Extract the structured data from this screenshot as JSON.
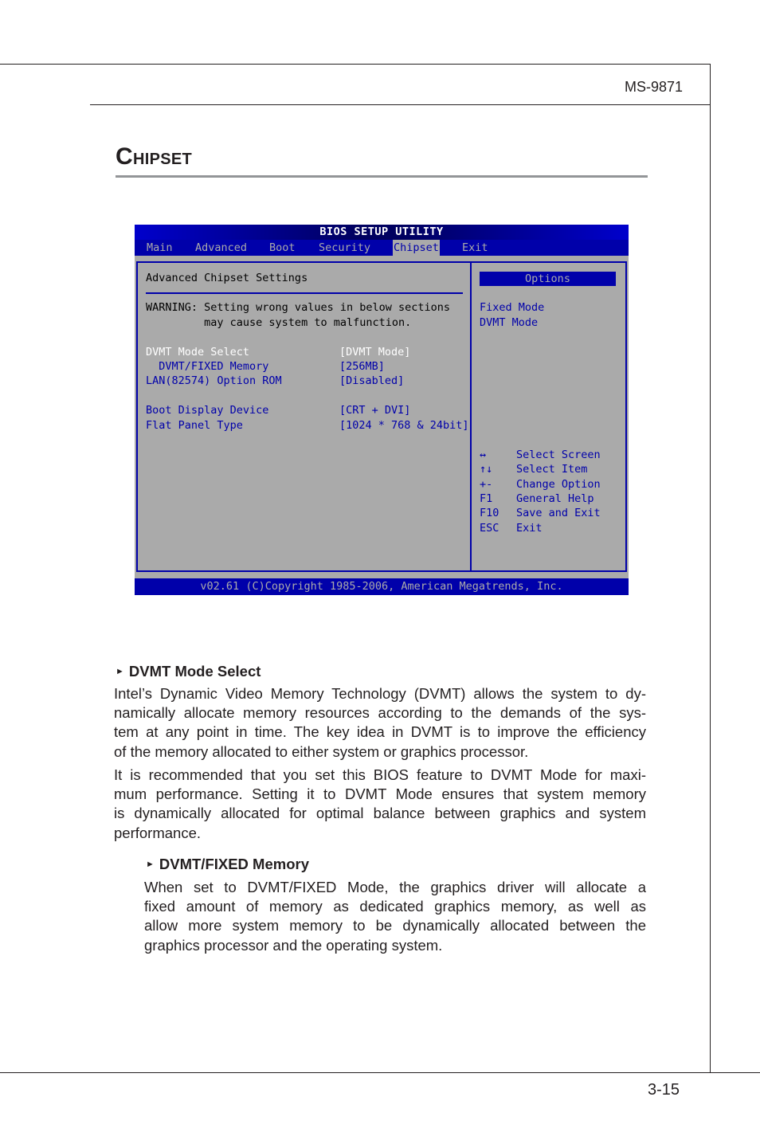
{
  "header": {
    "model": "MS-9871"
  },
  "section": {
    "title_cap": "C",
    "title_rest": "HIPSET"
  },
  "bios": {
    "title": "BIOS SETUP UTILITY",
    "tabs": [
      {
        "label": "Main",
        "active": false
      },
      {
        "label": "Advanced",
        "active": false
      },
      {
        "label": "Boot",
        "active": false
      },
      {
        "label": "Security",
        "active": false
      },
      {
        "label": "Chipset",
        "active": true
      },
      {
        "label": "Exit",
        "active": false
      }
    ],
    "panel_title": "Advanced Chipset Settings",
    "warning_line1": "WARNING: Setting wrong values in below sections",
    "warning_line2": "         may cause system to malfunction.",
    "settings": [
      {
        "label": "DVMT Mode Select",
        "value": "[DVMT Mode]",
        "selected": true
      },
      {
        "label": "  DVMT/FIXED Memory",
        "value": "[256MB]",
        "selected": false
      },
      {
        "label": "LAN(82574) Option ROM",
        "value": "[Disabled]",
        "selected": false
      },
      {
        "label": "Boot Display Device",
        "value": "[CRT + DVI]",
        "selected": false
      },
      {
        "label": "Flat Panel Type",
        "value": "[1024 * 768 & 24bit]",
        "selected": false
      }
    ],
    "options_header": "Options",
    "options": [
      "Fixed Mode",
      "DVMT Mode"
    ],
    "help": [
      {
        "key": "↔",
        "action": "Select Screen"
      },
      {
        "key": "↑↓",
        "action": "Select Item"
      },
      {
        "key": "+-",
        "action": "Change Option"
      },
      {
        "key": "F1",
        "action": "General Help"
      },
      {
        "key": "F10",
        "action": "Save and Exit"
      },
      {
        "key": "ESC",
        "action": "Exit"
      }
    ],
    "footer": "v02.61 (C)Copyright 1985-2006, American Megatrends, Inc."
  },
  "content": {
    "sub1": {
      "heading": "DVMT Mode Select",
      "para1": [
        "Intel’s Dynamic Video Memory Technology (DVMT) allows the system to dy-",
        "namically allocate memory resources according to the demands of the sys-",
        "tem at any point in time. The key idea in DVMT is to improve the efficiency",
        "of the memory allocated to either system or graphics processor."
      ],
      "para2": [
        "It is recommended that you set this BIOS feature to DVMT Mode for maxi-",
        "mum performance. Setting it to DVMT Mode ensures that system memory",
        "is dynamically allocated for optimal balance between graphics and system",
        "performance."
      ]
    },
    "sub2": {
      "heading": "DVMT/FIXED Memory",
      "para": [
        "When set to DVMT/FIXED Mode, the graphics driver will allocate a",
        "fixed amount of memory as dedicated graphics memory, as well as",
        "allow more system memory to be dynamically allocated between the",
        "graphics processor and the operating system."
      ]
    }
  },
  "footer": {
    "page_number": "3-15"
  }
}
